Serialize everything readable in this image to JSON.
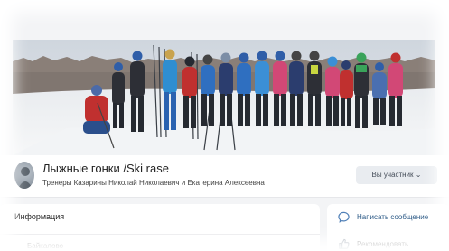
{
  "group": {
    "title": "Лыжные гонки /Ski rase",
    "subtitle": "Тренеры Казарины Николай Николаевич и Екатерина Алексеевна",
    "member_button": "Вы участник ⌄"
  },
  "info": {
    "title": "Информация",
    "row_label": "Байкалово"
  },
  "actions": [
    {
      "label": "Написать сообщение",
      "icon": "chat-bubble-icon"
    },
    {
      "label": "Рекомендовать",
      "icon": "thumbs-up-icon"
    }
  ],
  "colors": {
    "link": "#2a5885",
    "button_bg": "#e9ecf0",
    "page_bg": "#f3f4f6"
  }
}
